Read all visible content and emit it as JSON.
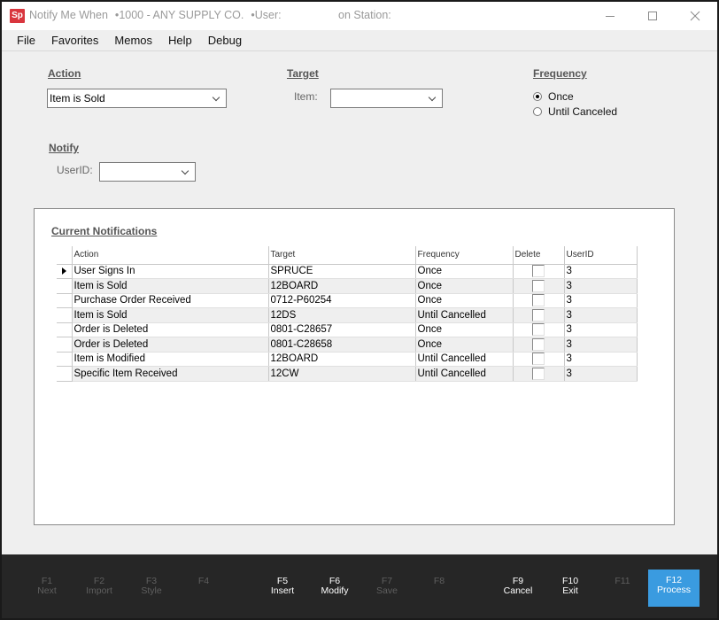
{
  "window": {
    "app_icon": "Sp",
    "title": "Notify Me When",
    "company": "1000 - ANY SUPPLY CO.",
    "user_label": "User:",
    "station_label": "on Station:",
    "separator": "•",
    "controls": {
      "minimize": "minimize-icon",
      "maximize": "maximize-icon",
      "close": "close-icon"
    }
  },
  "menu": [
    "File",
    "Favorites",
    "Memos",
    "Help",
    "Debug"
  ],
  "form": {
    "action": {
      "label": "Action",
      "value": "Item is Sold"
    },
    "target": {
      "label": "Target",
      "item_label": "Item:",
      "item_value": ""
    },
    "frequency": {
      "label": "Frequency",
      "options": [
        {
          "label": "Once",
          "selected": true
        },
        {
          "label": "Until Canceled",
          "selected": false
        }
      ]
    },
    "notify": {
      "label": "Notify",
      "userid_label": "UserID:",
      "userid_value": ""
    }
  },
  "notifications": {
    "title": "Current Notifications",
    "columns": [
      "Action",
      "Target",
      "Frequency",
      "Delete",
      "UserID"
    ],
    "current_row": 0,
    "rows": [
      {
        "action": "User Signs In",
        "target": "SPRUCE",
        "frequency": "Once",
        "delete": false,
        "userid": "3"
      },
      {
        "action": "Item is Sold",
        "target": "12BOARD",
        "frequency": "Once",
        "delete": false,
        "userid": "3"
      },
      {
        "action": "Purchase Order Received",
        "target": "0712-P60254",
        "frequency": "Once",
        "delete": false,
        "userid": "3"
      },
      {
        "action": "Item is Sold",
        "target": "12DS",
        "frequency": "Until Cancelled",
        "delete": false,
        "userid": "3"
      },
      {
        "action": "Order is Deleted",
        "target": "0801-C28657",
        "frequency": "Once",
        "delete": false,
        "userid": "3"
      },
      {
        "action": "Order is Deleted",
        "target": "0801-C28658",
        "frequency": "Once",
        "delete": false,
        "userid": "3"
      },
      {
        "action": "Item is Modified",
        "target": "12BOARD",
        "frequency": "Until Cancelled",
        "delete": false,
        "userid": "3"
      },
      {
        "action": "Specific Item Received",
        "target": "12CW",
        "frequency": "Until Cancelled",
        "delete": false,
        "userid": "3"
      }
    ]
  },
  "fkeys": [
    {
      "key": "F1",
      "label": "Next",
      "enabled": false
    },
    {
      "key": "F2",
      "label": "Import",
      "enabled": false
    },
    {
      "key": "F3",
      "label": "Style",
      "enabled": false
    },
    {
      "key": "F4",
      "label": "",
      "enabled": false
    },
    {
      "key": "F5",
      "label": "Insert",
      "enabled": true
    },
    {
      "key": "F6",
      "label": "Modify",
      "enabled": true
    },
    {
      "key": "F7",
      "label": "Save",
      "enabled": false
    },
    {
      "key": "F8",
      "label": "",
      "enabled": false
    },
    {
      "key": "F9",
      "label": "Cancel",
      "enabled": true
    },
    {
      "key": "F10",
      "label": "Exit",
      "enabled": true
    },
    {
      "key": "F11",
      "label": "",
      "enabled": false
    },
    {
      "key": "F12",
      "label": "Process",
      "enabled": true,
      "primary": true
    }
  ],
  "colors": {
    "app_icon": "#d9363e",
    "fkey_bar": "#262626",
    "primary_button": "#3a9be0"
  }
}
